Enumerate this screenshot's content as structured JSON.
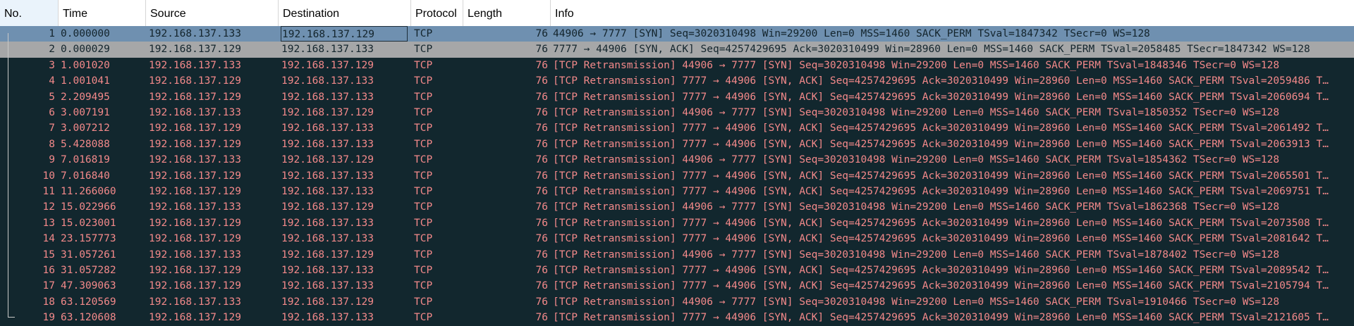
{
  "columns": {
    "no": "No.",
    "time": "Time",
    "source": "Source",
    "destination": "Destination",
    "protocol": "Protocol",
    "length": "Length",
    "info": "Info"
  },
  "packets": [
    {
      "no": "1",
      "time": "0.000000",
      "source": "192.168.137.133",
      "destination": "192.168.137.129",
      "protocol": "TCP",
      "length": "76",
      "info": "44906 → 7777 [SYN] Seq=3020310498 Win=29200 Len=0 MSS=1460 SACK_PERM TSval=1847342 TSecr=0 WS=128"
    },
    {
      "no": "2",
      "time": "0.000029",
      "source": "192.168.137.129",
      "destination": "192.168.137.133",
      "protocol": "TCP",
      "length": "76",
      "info": "7777 → 44906 [SYN, ACK] Seq=4257429695 Ack=3020310499 Win=28960 Len=0 MSS=1460 SACK_PERM TSval=2058485 TSecr=1847342 WS=128"
    },
    {
      "no": "3",
      "time": "1.001020",
      "source": "192.168.137.133",
      "destination": "192.168.137.129",
      "protocol": "TCP",
      "length": "76",
      "info": "[TCP Retransmission] 44906 → 7777 [SYN] Seq=3020310498 Win=29200 Len=0 MSS=1460 SACK_PERM TSval=1848346 TSecr=0 WS=128"
    },
    {
      "no": "4",
      "time": "1.001041",
      "source": "192.168.137.129",
      "destination": "192.168.137.133",
      "protocol": "TCP",
      "length": "76",
      "info": "[TCP Retransmission] 7777 → 44906 [SYN, ACK] Seq=4257429695 Ack=3020310499 Win=28960 Len=0 MSS=1460 SACK_PERM TSval=2059486 T…"
    },
    {
      "no": "5",
      "time": "2.209495",
      "source": "192.168.137.129",
      "destination": "192.168.137.133",
      "protocol": "TCP",
      "length": "76",
      "info": "[TCP Retransmission] 7777 → 44906 [SYN, ACK] Seq=4257429695 Ack=3020310499 Win=28960 Len=0 MSS=1460 SACK_PERM TSval=2060694 T…"
    },
    {
      "no": "6",
      "time": "3.007191",
      "source": "192.168.137.133",
      "destination": "192.168.137.129",
      "protocol": "TCP",
      "length": "76",
      "info": "[TCP Retransmission] 44906 → 7777 [SYN] Seq=3020310498 Win=29200 Len=0 MSS=1460 SACK_PERM TSval=1850352 TSecr=0 WS=128"
    },
    {
      "no": "7",
      "time": "3.007212",
      "source": "192.168.137.129",
      "destination": "192.168.137.133",
      "protocol": "TCP",
      "length": "76",
      "info": "[TCP Retransmission] 7777 → 44906 [SYN, ACK] Seq=4257429695 Ack=3020310499 Win=28960 Len=0 MSS=1460 SACK_PERM TSval=2061492 T…"
    },
    {
      "no": "8",
      "time": "5.428088",
      "source": "192.168.137.129",
      "destination": "192.168.137.133",
      "protocol": "TCP",
      "length": "76",
      "info": "[TCP Retransmission] 7777 → 44906 [SYN, ACK] Seq=4257429695 Ack=3020310499 Win=28960 Len=0 MSS=1460 SACK_PERM TSval=2063913 T…"
    },
    {
      "no": "9",
      "time": "7.016819",
      "source": "192.168.137.133",
      "destination": "192.168.137.129",
      "protocol": "TCP",
      "length": "76",
      "info": "[TCP Retransmission] 44906 → 7777 [SYN] Seq=3020310498 Win=29200 Len=0 MSS=1460 SACK_PERM TSval=1854362 TSecr=0 WS=128"
    },
    {
      "no": "10",
      "time": "7.016840",
      "source": "192.168.137.129",
      "destination": "192.168.137.133",
      "protocol": "TCP",
      "length": "76",
      "info": "[TCP Retransmission] 7777 → 44906 [SYN, ACK] Seq=4257429695 Ack=3020310499 Win=28960 Len=0 MSS=1460 SACK_PERM TSval=2065501 T…"
    },
    {
      "no": "11",
      "time": "11.266060",
      "source": "192.168.137.129",
      "destination": "192.168.137.133",
      "protocol": "TCP",
      "length": "76",
      "info": "[TCP Retransmission] 7777 → 44906 [SYN, ACK] Seq=4257429695 Ack=3020310499 Win=28960 Len=0 MSS=1460 SACK_PERM TSval=2069751 T…"
    },
    {
      "no": "12",
      "time": "15.022966",
      "source": "192.168.137.133",
      "destination": "192.168.137.129",
      "protocol": "TCP",
      "length": "76",
      "info": "[TCP Retransmission] 44906 → 7777 [SYN] Seq=3020310498 Win=29200 Len=0 MSS=1460 SACK_PERM TSval=1862368 TSecr=0 WS=128"
    },
    {
      "no": "13",
      "time": "15.023001",
      "source": "192.168.137.129",
      "destination": "192.168.137.133",
      "protocol": "TCP",
      "length": "76",
      "info": "[TCP Retransmission] 7777 → 44906 [SYN, ACK] Seq=4257429695 Ack=3020310499 Win=28960 Len=0 MSS=1460 SACK_PERM TSval=2073508 T…"
    },
    {
      "no": "14",
      "time": "23.157773",
      "source": "192.168.137.129",
      "destination": "192.168.137.133",
      "protocol": "TCP",
      "length": "76",
      "info": "[TCP Retransmission] 7777 → 44906 [SYN, ACK] Seq=4257429695 Ack=3020310499 Win=28960 Len=0 MSS=1460 SACK_PERM TSval=2081642 T…"
    },
    {
      "no": "15",
      "time": "31.057261",
      "source": "192.168.137.133",
      "destination": "192.168.137.129",
      "protocol": "TCP",
      "length": "76",
      "info": "[TCP Retransmission] 44906 → 7777 [SYN] Seq=3020310498 Win=29200 Len=0 MSS=1460 SACK_PERM TSval=1878402 TSecr=0 WS=128"
    },
    {
      "no": "16",
      "time": "31.057282",
      "source": "192.168.137.129",
      "destination": "192.168.137.133",
      "protocol": "TCP",
      "length": "76",
      "info": "[TCP Retransmission] 7777 → 44906 [SYN, ACK] Seq=4257429695 Ack=3020310499 Win=28960 Len=0 MSS=1460 SACK_PERM TSval=2089542 T…"
    },
    {
      "no": "17",
      "time": "47.309063",
      "source": "192.168.137.129",
      "destination": "192.168.137.133",
      "protocol": "TCP",
      "length": "76",
      "info": "[TCP Retransmission] 7777 → 44906 [SYN, ACK] Seq=4257429695 Ack=3020310499 Win=28960 Len=0 MSS=1460 SACK_PERM TSval=2105794 T…"
    },
    {
      "no": "18",
      "time": "63.120569",
      "source": "192.168.137.133",
      "destination": "192.168.137.129",
      "protocol": "TCP",
      "length": "76",
      "info": "[TCP Retransmission] 44906 → 7777 [SYN] Seq=3020310498 Win=29200 Len=0 MSS=1460 SACK_PERM TSval=1910466 TSecr=0 WS=128"
    },
    {
      "no": "19",
      "time": "63.120608",
      "source": "192.168.137.129",
      "destination": "192.168.137.133",
      "protocol": "TCP",
      "length": "76",
      "info": "[TCP Retransmission] 7777 → 44906 [SYN, ACK] Seq=4257429695 Ack=3020310499 Win=28960 Len=0 MSS=1460 SACK_PERM TSval=2121605 T…"
    }
  ],
  "colors": {
    "list_background": "#12272e",
    "retransmission_text": "#f3898a",
    "selected_row": "#6f90b0",
    "related_row": "#a6a7a8",
    "header_background": "#ffffff"
  }
}
